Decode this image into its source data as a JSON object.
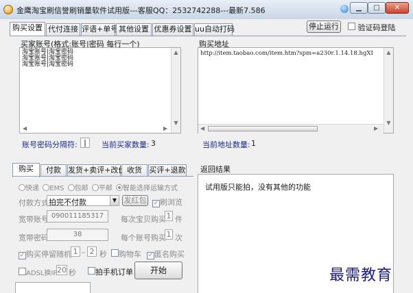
{
  "window": {
    "title": "金鹰淘宝刷信誉刷销量软件试用版---客服QQ：2532742288---最新7.586",
    "min_glyph": "▁",
    "max_glyph": "□",
    "close_glyph": "✕"
  },
  "tabs": [
    "购买设置",
    "代付连接",
    "评语+单号",
    "其他设置",
    "优惠券设置",
    "uu自动打码"
  ],
  "top_actions": {
    "stop_label": "停止运行",
    "captcha_label": "验证码登陆"
  },
  "buyer_section": {
    "label": "买家账号(格式:账号|密码 每行一个)",
    "lines": [
      "淘宝账号|淘宝密码",
      "淘宝账号|淘宝密码",
      "淘宝账号|淘宝密码"
    ],
    "separator_label": "账号密码分隔符:",
    "separator_value": "|",
    "count_label": "当前买家数量:",
    "count_value": "3"
  },
  "url_section": {
    "label": "购买地址",
    "url": "http://item.taobao.com/item.htm?spm=a230r.1.14.18.hgXI",
    "count_label": "当前地址数量:",
    "count_value": "1"
  },
  "lower_tabs": [
    "购买",
    "付款",
    "发货+卖评+改价",
    "收货",
    "买评+退款"
  ],
  "shipping": {
    "options": [
      "快递",
      "EMS",
      "包邮",
      "平邮",
      "智能选择运输方式"
    ],
    "selected_index": 4
  },
  "payment": {
    "label": "付款方式",
    "value": "拍完不付款",
    "red_packet_label": "发红包",
    "browse_label": "刷浏览"
  },
  "broadband": {
    "account_label": "宽带账号",
    "account_value": "090011185317",
    "password_label": "宽带密码",
    "password_value": "38"
  },
  "per_product": {
    "label": "每次宝贝购买",
    "value": "1",
    "unit": "件"
  },
  "per_account": {
    "label": "每个账号购买",
    "value": "1",
    "unit": "次"
  },
  "random_wait": {
    "label": "购买停留随机",
    "from": "1",
    "to": "2",
    "unit": "秒"
  },
  "cart_label": "购物车",
  "anonymous_label": "匿名购买",
  "adsl": {
    "label": "ADSL换IP",
    "value": "20",
    "unit": "秒"
  },
  "mobile_order_label": "拍手机订单",
  "start_label": "开始",
  "result": {
    "label": "返回结果",
    "text": "试用版只能拍，没有其他的功能"
  },
  "watermark": "最需教育",
  "colors": {
    "accent_blue": "#1c2a8c",
    "close_red": "#c9452c",
    "watermark": "#1a1a8a"
  }
}
